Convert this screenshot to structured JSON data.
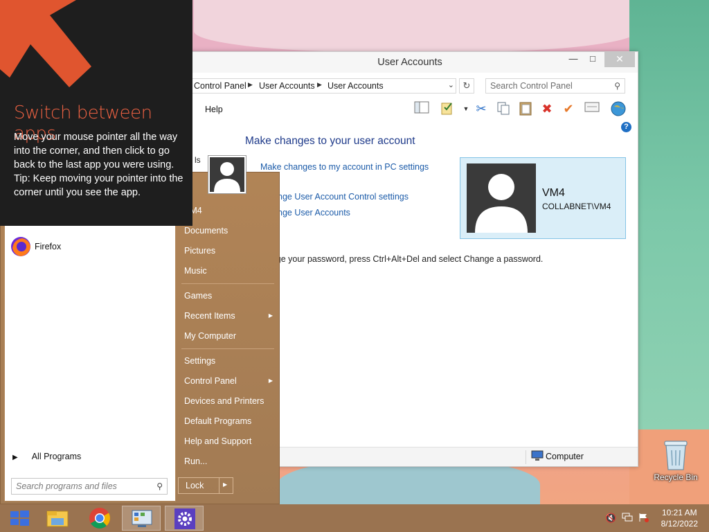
{
  "tip": {
    "title": "Switch between apps",
    "body": "Move your mouse pointer all the way into the corner, and then click to go back to the last app you were using.",
    "tip": "Tip: Keep moving your pointer into the corner until you see the app.",
    "accent_color": "#ec6142"
  },
  "window": {
    "title": "User Accounts",
    "breadcrumb": [
      "Control Panel",
      "User Accounts",
      "User Accounts"
    ],
    "search_placeholder": "Search Control Panel",
    "menu": {
      "help": "Help"
    },
    "heading": "Make changes to your user account",
    "stub_text": "ls",
    "links": {
      "pc_settings": "Make changes to my account in PC settings",
      "uac": "nge User Account Control settings",
      "manage": "nge User Accounts"
    },
    "password_note": "To change your password, press Ctrl+Alt+Del and select Change a password.",
    "user": {
      "name": "VM4",
      "domain": "COLLABNET\\VM4"
    },
    "status": {
      "location": "Computer"
    }
  },
  "start_menu": {
    "programs": [
      {
        "label": "Firefox",
        "icon": "firefox-icon"
      }
    ],
    "all_programs": "All Programs",
    "search_placeholder": "Search programs and files",
    "user_label": "VM4",
    "right_items": [
      {
        "label": "Documents",
        "arrow": false
      },
      {
        "label": "Pictures",
        "arrow": false
      },
      {
        "label": "Music",
        "arrow": false
      },
      {
        "label": "Games",
        "arrow": false
      },
      {
        "label": "Recent Items",
        "arrow": true
      },
      {
        "label": "My Computer",
        "arrow": false
      },
      {
        "label": "Settings",
        "arrow": false
      },
      {
        "label": "Control Panel",
        "arrow": true
      },
      {
        "label": "Devices and Printers",
        "arrow": false
      },
      {
        "label": "Default Programs",
        "arrow": false
      },
      {
        "label": "Help and Support",
        "arrow": false
      },
      {
        "label": "Run...",
        "arrow": false
      }
    ],
    "lock": "Lock"
  },
  "desktop": {
    "recycle_bin": "Recycle Bin"
  },
  "taskbar": {
    "time": "10:21 AM",
    "date": "8/12/2022"
  }
}
